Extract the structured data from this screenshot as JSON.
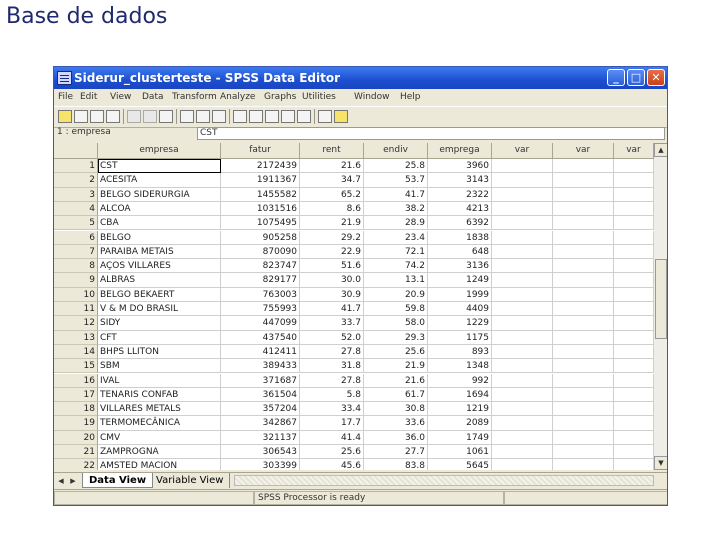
{
  "slide_title": "Base de dados",
  "window": {
    "title": "Siderur_clusterteste - SPSS Data Editor",
    "controls": [
      "_",
      "□",
      "✕"
    ]
  },
  "menu": [
    "File",
    "Edit",
    "View",
    "Data",
    "Transform",
    "Analyze",
    "Graphs",
    "Utilities",
    "Window",
    "Help"
  ],
  "cell_editor": {
    "ref": "1 : empresa",
    "value": "CST"
  },
  "columns": [
    "empresa",
    "fatur",
    "rent",
    "endiv",
    "emprega",
    "var",
    "var",
    "var"
  ],
  "rows": [
    {
      "n": "1",
      "empresa": "CST",
      "fatur": "2172439",
      "rent": "21.6",
      "endiv": "25.8",
      "emprega": "3960"
    },
    {
      "n": "2",
      "empresa": "ACESITA",
      "fatur": "1911367",
      "rent": "34.7",
      "endiv": "53.7",
      "emprega": "3143"
    },
    {
      "n": "3",
      "empresa": "BELGO SIDERURGIA",
      "fatur": "1455582",
      "rent": "65.2",
      "endiv": "41.7",
      "emprega": "2322"
    },
    {
      "n": "4",
      "empresa": "ALCOA",
      "fatur": "1031516",
      "rent": "8.6",
      "endiv": "38.2",
      "emprega": "4213"
    },
    {
      "n": "5",
      "empresa": "CBA",
      "fatur": "1075495",
      "rent": "21.9",
      "endiv": "28.9",
      "emprega": "6392"
    },
    {
      "n": "6",
      "empresa": "BELGO",
      "fatur": "905258",
      "rent": "29.2",
      "endiv": "23.4",
      "emprega": "1838"
    },
    {
      "n": "7",
      "empresa": "PARAIBA METAIS",
      "fatur": "870090",
      "rent": "22.9",
      "endiv": "72.1",
      "emprega": "648"
    },
    {
      "n": "8",
      "empresa": "AÇOS VILLARES",
      "fatur": "823747",
      "rent": "51.6",
      "endiv": "74.2",
      "emprega": "3136"
    },
    {
      "n": "9",
      "empresa": "ALBRAS",
      "fatur": "829177",
      "rent": "30.0",
      "endiv": "13.1",
      "emprega": "1249"
    },
    {
      "n": "10",
      "empresa": "BELGO BEKAERT",
      "fatur": "763003",
      "rent": "30.9",
      "endiv": "20.9",
      "emprega": "1999"
    },
    {
      "n": "11",
      "empresa": "V & M DO BRASIL",
      "fatur": "755993",
      "rent": "41.7",
      "endiv": "59.8",
      "emprega": "4409"
    },
    {
      "n": "12",
      "empresa": "SIDY",
      "fatur": "447099",
      "rent": "33.7",
      "endiv": "58.0",
      "emprega": "1229"
    },
    {
      "n": "13",
      "empresa": "CFT",
      "fatur": "437540",
      "rent": "52.0",
      "endiv": "29.3",
      "emprega": "1175"
    },
    {
      "n": "14",
      "empresa": "BHPS LLITON",
      "fatur": "412411",
      "rent": "27.8",
      "endiv": "25.6",
      "emprega": "893"
    },
    {
      "n": "15",
      "empresa": "SBM",
      "fatur": "389433",
      "rent": "31.8",
      "endiv": "21.9",
      "emprega": "1348"
    },
    {
      "n": "16",
      "empresa": "IVAL",
      "fatur": "371687",
      "rent": "27.8",
      "endiv": "21.6",
      "emprega": "992"
    },
    {
      "n": "17",
      "empresa": "TENARIS CONFAB",
      "fatur": "361504",
      "rent": "5.8",
      "endiv": "61.7",
      "emprega": "1694"
    },
    {
      "n": "18",
      "empresa": "VILLARES METALS",
      "fatur": "357204",
      "rent": "33.4",
      "endiv": "30.8",
      "emprega": "1219"
    },
    {
      "n": "19",
      "empresa": "TERMOMECÂNICA",
      "fatur": "342867",
      "rent": "17.7",
      "endiv": "33.6",
      "emprega": "2089"
    },
    {
      "n": "20",
      "empresa": "CMV",
      "fatur": "321137",
      "rent": "41.4",
      "endiv": "36.0",
      "emprega": "1749"
    },
    {
      "n": "21",
      "empresa": "ZAMPROGNA",
      "fatur": "306543",
      "rent": "25.6",
      "endiv": "27.7",
      "emprega": "1061"
    },
    {
      "n": "22",
      "empresa": "AMSTED MACION",
      "fatur": "303399",
      "rent": "45.6",
      "endiv": "83.8",
      "emprega": "5645"
    }
  ],
  "tabs": {
    "data_view": "Data View",
    "variable_view": "Variable View"
  },
  "status": "SPSS Processor  is ready"
}
